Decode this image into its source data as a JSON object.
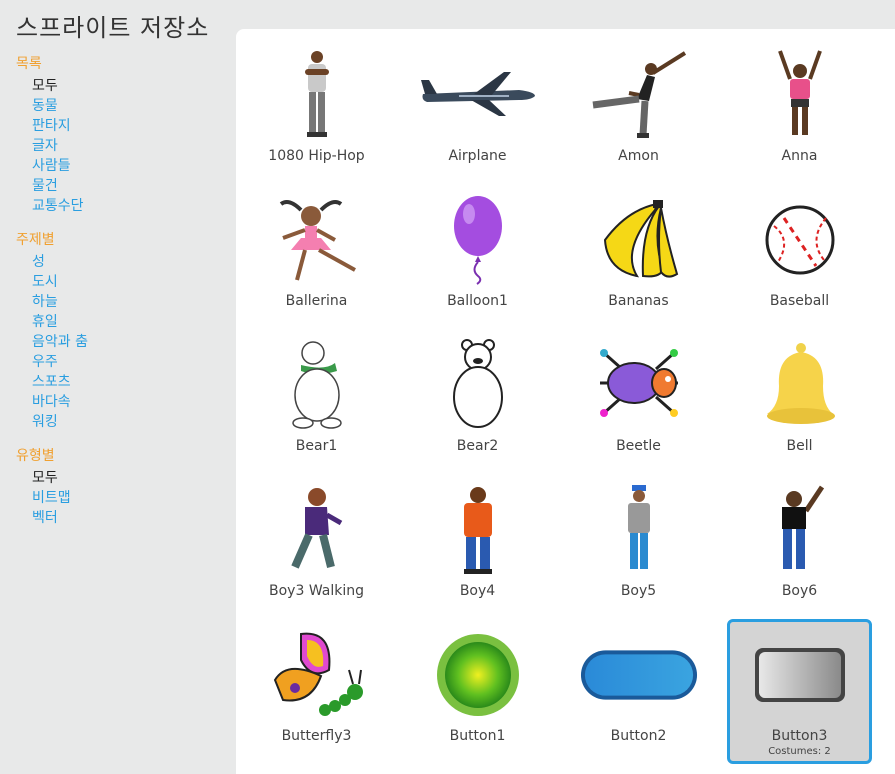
{
  "app": {
    "title": "스프라이트 저장소"
  },
  "sidebar": {
    "groups": [
      {
        "heading": "목록",
        "items": [
          "모두",
          "동물",
          "판타지",
          "글자",
          "사람들",
          "물건",
          "교통수단"
        ],
        "selected": 0
      },
      {
        "heading": "주제별",
        "items": [
          "성",
          "도시",
          "하늘",
          "휴일",
          "음악과 춤",
          "우주",
          "스포츠",
          "바다속",
          "워킹"
        ],
        "selected": -1
      },
      {
        "heading": "유형별",
        "items": [
          "모두",
          "비트맵",
          "벡터"
        ],
        "selected": 0
      }
    ]
  },
  "sprites": [
    {
      "name": "1080 Hip-Hop",
      "icon": "hiphop-dancer-icon"
    },
    {
      "name": "Airplane",
      "icon": "airplane-icon"
    },
    {
      "name": "Amon",
      "icon": "amon-dancer-icon"
    },
    {
      "name": "Anna",
      "icon": "anna-dancer-icon"
    },
    {
      "name": "Ballerina",
      "icon": "ballerina-icon"
    },
    {
      "name": "Balloon1",
      "icon": "balloon-icon"
    },
    {
      "name": "Bananas",
      "icon": "bananas-icon"
    },
    {
      "name": "Baseball",
      "icon": "baseball-icon"
    },
    {
      "name": "Bear1",
      "icon": "polar-bear-icon"
    },
    {
      "name": "Bear2",
      "icon": "bear-outline-icon"
    },
    {
      "name": "Beetle",
      "icon": "beetle-icon"
    },
    {
      "name": "Bell",
      "icon": "bell-icon"
    },
    {
      "name": "Boy3 Walking",
      "icon": "boy-walking-icon"
    },
    {
      "name": "Boy4",
      "icon": "boy-orange-jacket-icon"
    },
    {
      "name": "Boy5",
      "icon": "boy-cap-icon"
    },
    {
      "name": "Boy6",
      "icon": "boy-waving-icon"
    },
    {
      "name": "Butterfly3",
      "icon": "butterfly-caterpillar-icon"
    },
    {
      "name": "Button1",
      "icon": "round-green-button-icon"
    },
    {
      "name": "Button2",
      "icon": "blue-pill-button-icon"
    },
    {
      "name": "Button3",
      "icon": "gray-rect-button-icon",
      "costumes": "Costumes: 2",
      "selected": true
    }
  ]
}
